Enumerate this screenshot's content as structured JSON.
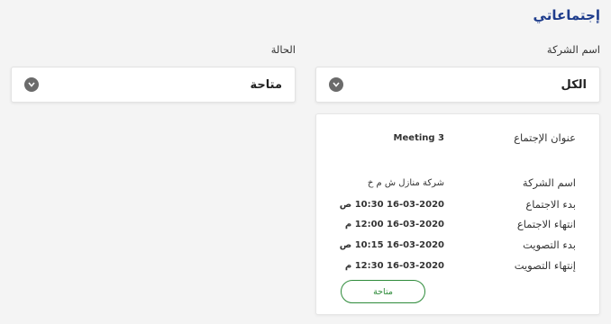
{
  "page": {
    "title": "إجتماعاتي"
  },
  "filters": {
    "company": {
      "label": "اسم الشركة",
      "value": "الكل"
    },
    "status": {
      "label": "الحالة",
      "value": "متاحة"
    }
  },
  "meeting_card": {
    "rows": [
      {
        "label": "عنوان الإجتماع",
        "value": "Meeting 3"
      },
      {
        "label": "اسم الشركة",
        "value": "شركة منازل ش م خ"
      },
      {
        "label": "بدء الاجتماع",
        "value": "16-03-2020 10:30 ص"
      },
      {
        "label": "انتهاء الاجتماع",
        "value": "16-03-2020 12:00 م"
      },
      {
        "label": "بدء التصويت",
        "value": "16-03-2020 10:15 ص"
      },
      {
        "label": "إنتهاء التصويت",
        "value": "16-03-2020 12:30 م"
      }
    ],
    "status_button": "متاحة"
  },
  "colors": {
    "title": "#1e3c8c",
    "status_green": "#2e8b3a",
    "chevron": "#6b6b6b"
  },
  "icons": {
    "dropdown": "chevron-down-icon"
  }
}
